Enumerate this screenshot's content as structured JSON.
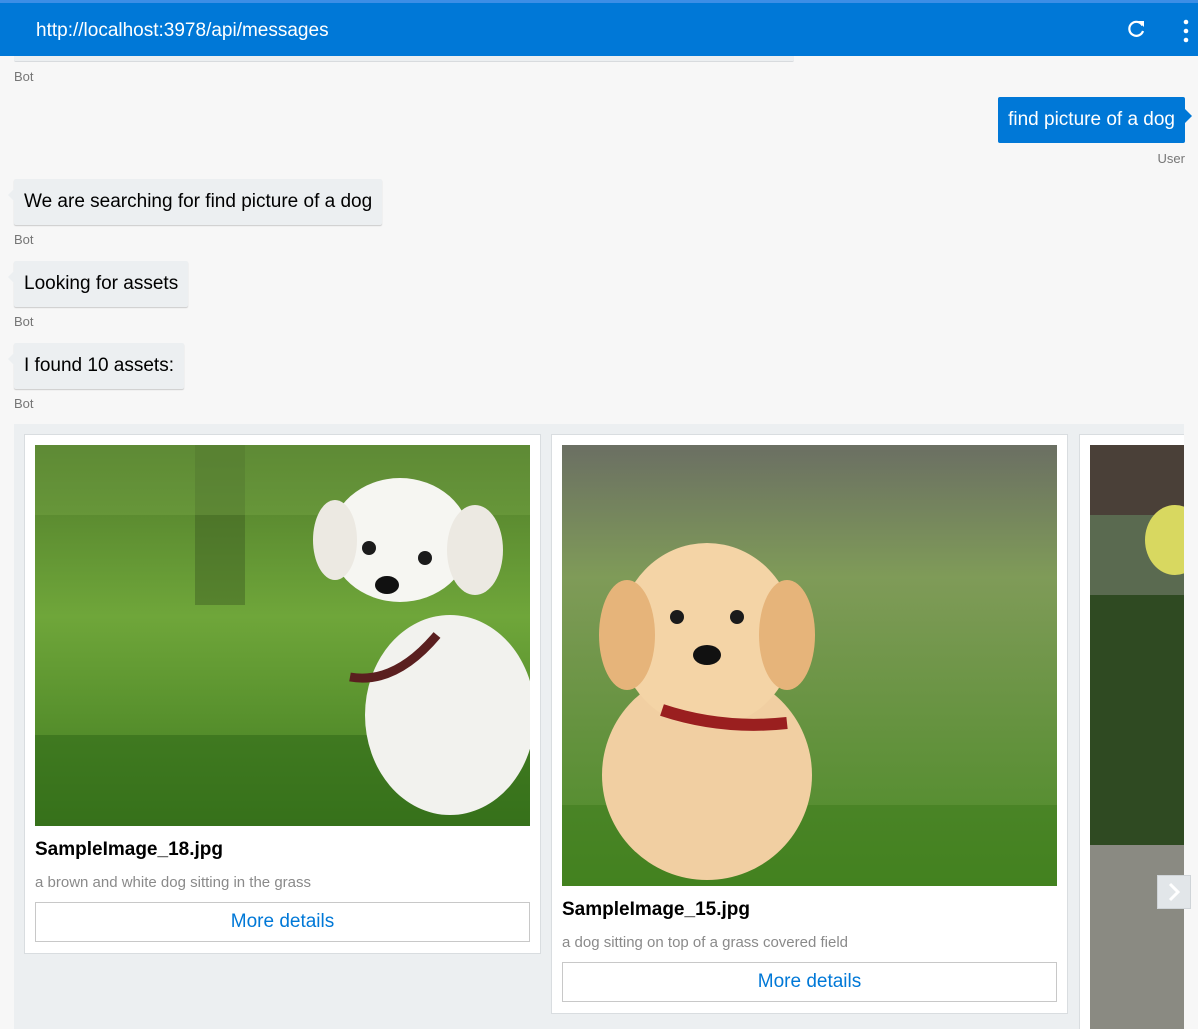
{
  "header": {
    "url": "http://localhost:3978/api/messages",
    "refresh_icon": "refresh-icon",
    "menu_icon": "more-vertical-icon"
  },
  "colors": {
    "accent": "#0078d7",
    "bot_bubble": "#eceff1",
    "background": "#f7f7f7"
  },
  "messages": [
    {
      "from": "Bot",
      "text": ""
    },
    {
      "from": "User",
      "text": "find picture of a dog"
    },
    {
      "from": "Bot",
      "text": "We are searching for find picture of a dog"
    },
    {
      "from": "Bot",
      "text": "Looking for assets"
    },
    {
      "from": "Bot",
      "text": "I found 10 assets:"
    }
  ],
  "carousel": {
    "cards": [
      {
        "title": "SampleImage_18.jpg",
        "subtitle": "a brown and white dog sitting in the grass",
        "button": "More details"
      },
      {
        "title": "SampleImage_15.jpg",
        "subtitle": "a dog sitting on top of a grass covered field",
        "button": "More details"
      }
    ],
    "next_icon": "chevron-right-icon"
  }
}
